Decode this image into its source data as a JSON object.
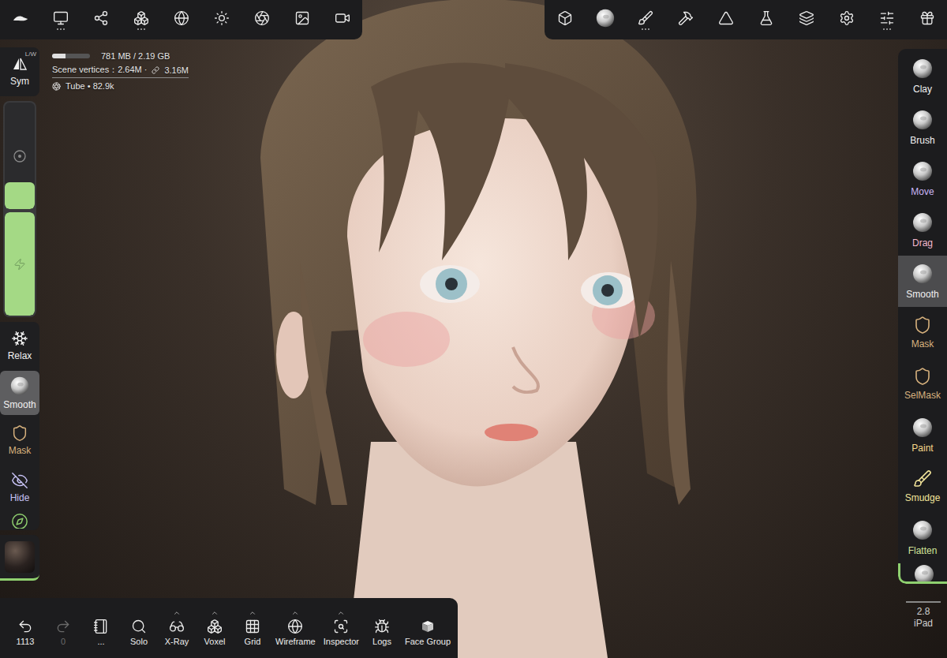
{
  "top_left_toolbar": [
    {
      "has_more": false
    },
    {
      "has_more": true
    },
    {
      "has_more": false
    },
    {
      "has_more": true
    },
    {
      "has_more": false
    },
    {
      "has_more": false
    },
    {
      "has_more": false
    },
    {
      "has_more": false
    },
    {
      "has_more": false
    }
  ],
  "top_right_toolbar": [
    {
      "has_more": false
    },
    {
      "has_more": false
    },
    {
      "has_more": true
    },
    {
      "has_more": false
    },
    {
      "has_more": false
    },
    {
      "has_more": false
    },
    {
      "has_more": false
    },
    {
      "has_more": false
    },
    {
      "has_more": true
    },
    {
      "has_more": false
    }
  ],
  "stats": {
    "memory": {
      "text": "781 MB / 2.19 GB",
      "level": 0.36
    },
    "vertices": "Scene vertices：2.64M ·",
    "links": "3.16M",
    "object": "Tube • 82.9k"
  },
  "symmetry": {
    "label": "Sym",
    "mode": "L/W"
  },
  "sliders": [
    {
      "level": 0.25
    },
    {
      "level": 1
    }
  ],
  "left_tools": [
    {
      "label": "Relax",
      "selected": false,
      "color": "#f2f2f2"
    },
    {
      "label": "Smooth",
      "selected": true,
      "color": "#f2f2f2"
    },
    {
      "label": "Mask",
      "selected": false,
      "color": "#d8b27e"
    },
    {
      "label": "Hide",
      "selected": false,
      "color": "#c7c2f5"
    }
  ],
  "bottom_toolbar": {
    "undo": {
      "label": "1113",
      "disabled": false
    },
    "redo": {
      "label": "0",
      "disabled": true
    },
    "items": [
      {
        "label": "...",
        "has_options": false
      },
      {
        "label": "Solo",
        "has_options": false
      },
      {
        "label": "X-Ray",
        "has_options": true
      },
      {
        "label": "Voxel",
        "has_options": true
      },
      {
        "label": "Grid",
        "has_options": true
      },
      {
        "label": "Wireframe",
        "has_options": true
      },
      {
        "label": "Inspector",
        "has_options": true
      },
      {
        "label": "Logs",
        "has_options": false
      },
      {
        "label": "Face Group",
        "has_options": false
      }
    ]
  },
  "right_tools": [
    {
      "label": "Clay",
      "selected": false,
      "color": "#f2f2f2"
    },
    {
      "label": "Brush",
      "selected": false,
      "color": "#f2f2f2"
    },
    {
      "label": "Move",
      "selected": false,
      "color": "#c9b6f7"
    },
    {
      "label": "Drag",
      "selected": false,
      "color": "#f3b9cf"
    },
    {
      "label": "Smooth",
      "selected": true,
      "color": "#f2f2f2"
    },
    {
      "label": "Mask",
      "selected": false,
      "color": "#d8b27e"
    },
    {
      "label": "SelMask",
      "selected": false,
      "color": "#d8b27e"
    },
    {
      "label": "Paint",
      "selected": false,
      "color": "#f7d98a"
    },
    {
      "label": "Smudge",
      "selected": false,
      "color": "#f2e49a"
    },
    {
      "label": "Flatten",
      "selected": false,
      "color": "#d3e69a"
    }
  ],
  "version": {
    "number": "2.8",
    "device": "iPad"
  }
}
